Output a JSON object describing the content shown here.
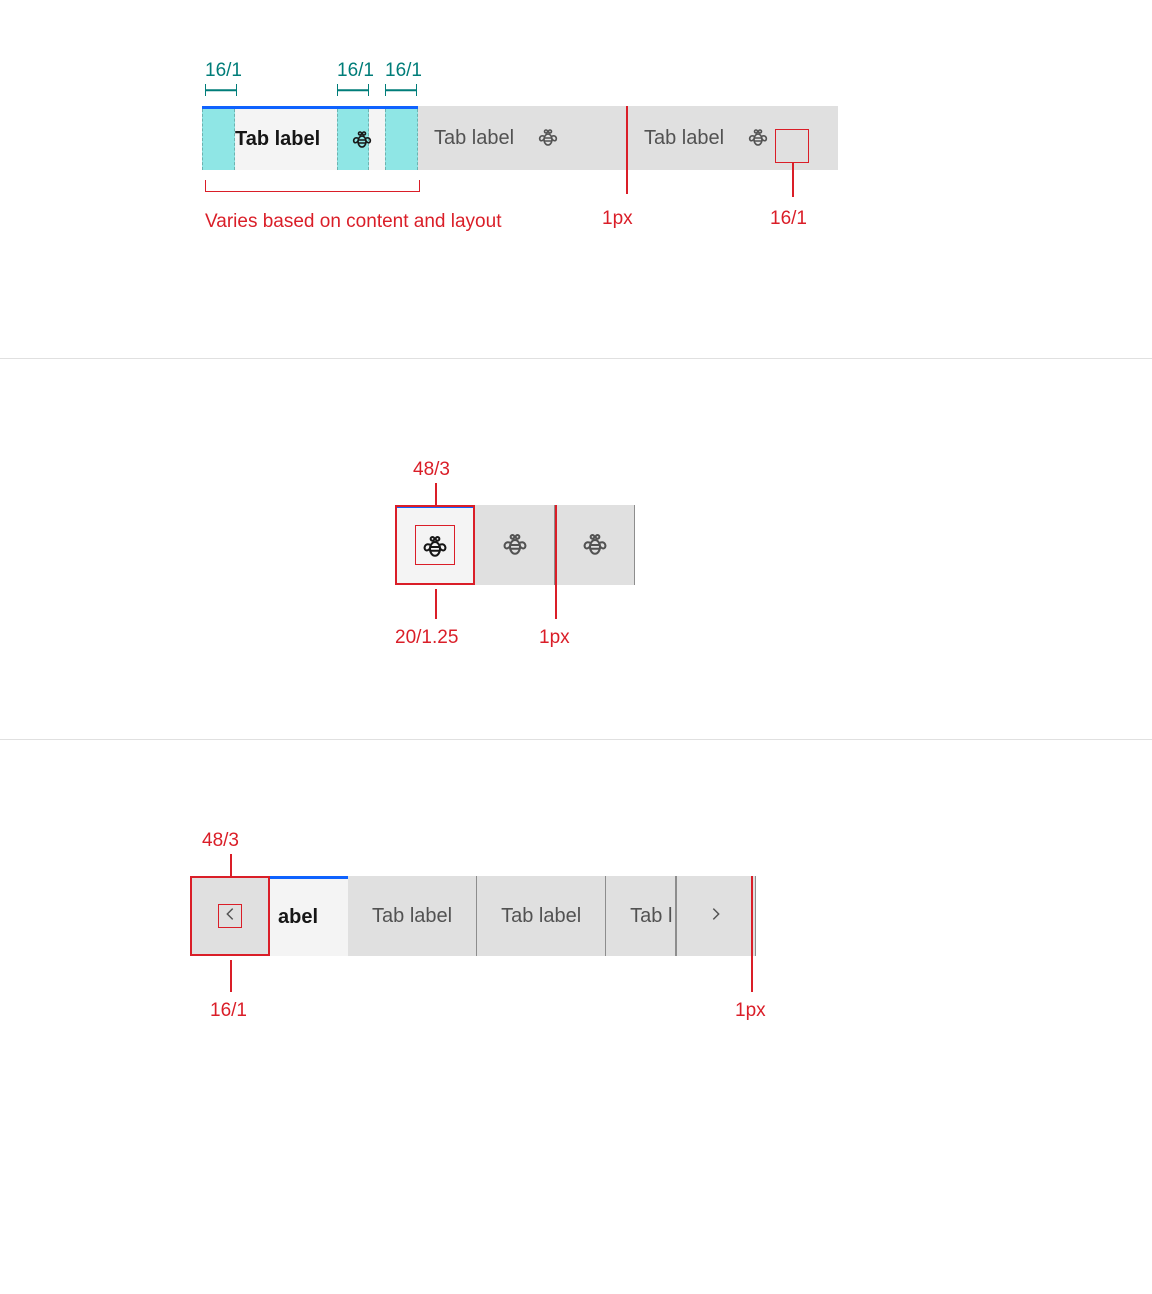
{
  "colors": {
    "teal_label": "#007d79",
    "teal_highlight": "#3ddbd9",
    "magenta": "#da1e28",
    "accent_blue": "#0f62fe",
    "tab_bg": "#e0e0e0",
    "tab_active_bg": "#f4f4f4",
    "text_secondary": "#525252",
    "border": "#8d8d8d"
  },
  "figure1": {
    "padding_annotations": {
      "left": "16/1",
      "middle": "16/1",
      "right": "16/1"
    },
    "tabs": [
      {
        "label": "Tab label",
        "has_icon": true,
        "active": true
      },
      {
        "label": "Tab label",
        "has_icon": true,
        "active": false
      },
      {
        "label": "Tab label",
        "has_icon": true,
        "active": false
      }
    ],
    "width_note": "Varies based on content and layout",
    "divider_label": "1px",
    "icon_size_label": "16/1"
  },
  "figure2": {
    "tab_size_label": "48/3",
    "tabs_icon_only": [
      {
        "active": true
      },
      {
        "active": false
      },
      {
        "active": false
      }
    ],
    "icon_size_label": "20/1.25",
    "divider_label": "1px"
  },
  "figure3": {
    "scroll_btn_size_label": "48/3",
    "active_tab_label_cut": "abel",
    "tabs": [
      {
        "label": "Tab label",
        "active": false
      },
      {
        "label": "Tab label",
        "active": false
      },
      {
        "label": "Tab l",
        "active": false,
        "truncated": true
      }
    ],
    "chevron_size_label": "16/1",
    "divider_label": "1px"
  }
}
